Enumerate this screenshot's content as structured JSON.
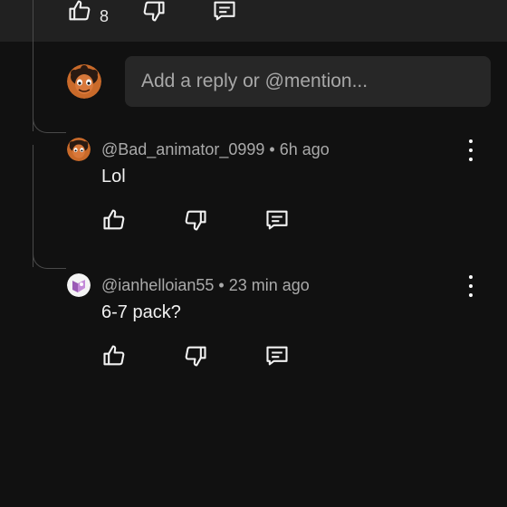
{
  "top_comment": {
    "like_count": "8"
  },
  "reply_box": {
    "placeholder": "Add a reply or @mention..."
  },
  "replies": [
    {
      "author": "@Bad_animator_0999",
      "time": "6h ago",
      "text": "Lol"
    },
    {
      "author": "@ianhelloian55",
      "time": "23 min ago",
      "text": "6-7 pack?"
    }
  ],
  "colors": {
    "background": "#111111",
    "top_bar": "#212121",
    "input_bg": "#272727",
    "meta_text": "#aaaaaa",
    "primary_text": "#f1f1f1"
  },
  "icons": [
    "like-icon",
    "dislike-icon",
    "reply-icon",
    "more-vert-icon"
  ]
}
